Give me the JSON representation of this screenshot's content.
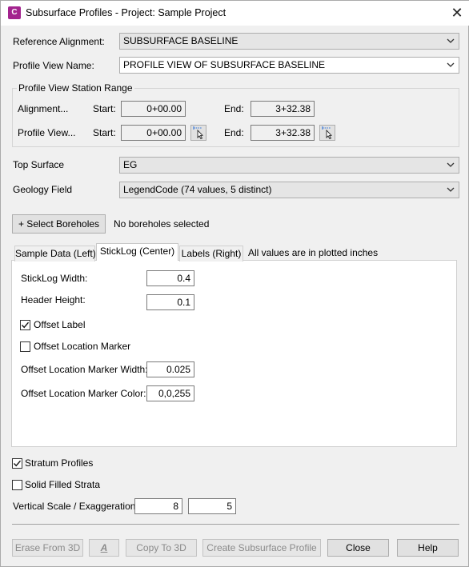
{
  "window": {
    "icon_letter": "C",
    "title": "Subsurface Profiles - Project: Sample Project",
    "close_symbol": "✕"
  },
  "reference_alignment": {
    "label": "Reference Alignment:",
    "value": "SUBSURFACE BASELINE"
  },
  "profile_view_name": {
    "label": "Profile View Name:",
    "value": "PROFILE VIEW OF SUBSURFACE BASELINE"
  },
  "station_range": {
    "title": "Profile View Station Range",
    "alignment_row": {
      "label": "Alignment...",
      "start_label": "Start:",
      "start_value": "0+00.00",
      "end_label": "End:",
      "end_value": "3+32.38"
    },
    "profile_view_row": {
      "label": "Profile View...",
      "start_label": "Start:",
      "start_value": "0+00.00",
      "end_label": "End:",
      "end_value": "3+32.38"
    }
  },
  "top_surface": {
    "label": "Top Surface",
    "value": "EG"
  },
  "geology_field": {
    "label": "Geology Field",
    "value": "LegendCode (74 values, 5 distinct)"
  },
  "boreholes": {
    "button_label": "+ Select Boreholes",
    "status": "No boreholes selected"
  },
  "tabs": {
    "items": [
      {
        "label": "Sample Data (Left)"
      },
      {
        "label": "StickLog (Center)"
      },
      {
        "label": "Labels (Right)"
      }
    ],
    "note": "All values are in plotted inches"
  },
  "sticklog": {
    "width_label": "StickLog Width:",
    "width_value": "0.4",
    "header_label": "Header Height:",
    "header_value": "0.1",
    "offset_label_text": "Offset Label",
    "offset_label_checked": true,
    "offset_marker_text": "Offset Location Marker",
    "offset_marker_checked": false,
    "marker_width_label": "Offset Location Marker Width:",
    "marker_width_value": "0.025",
    "marker_color_label": "Offset Location Marker Color:",
    "marker_color_value": "0,0,255"
  },
  "options": {
    "stratum_profiles_label": "Stratum Profiles",
    "stratum_profiles_checked": true,
    "solid_filled_label": "Solid Filled Strata",
    "solid_filled_checked": false,
    "vertical_scale_label": "Vertical Scale / Exaggeration:",
    "vertical_scale_value": "8",
    "exaggeration_value": "5"
  },
  "footer": {
    "erase_label": "Erase From 3D",
    "annotate_label": "A",
    "copy_label": "Copy To 3D",
    "create_label": "Create Subsurface Profile",
    "close_label": "Close",
    "help_label": "Help"
  },
  "colors": {
    "app_icon": "#a3238e",
    "dialog_bg": "#f0f0f0",
    "accent_select": "#0078d7"
  }
}
